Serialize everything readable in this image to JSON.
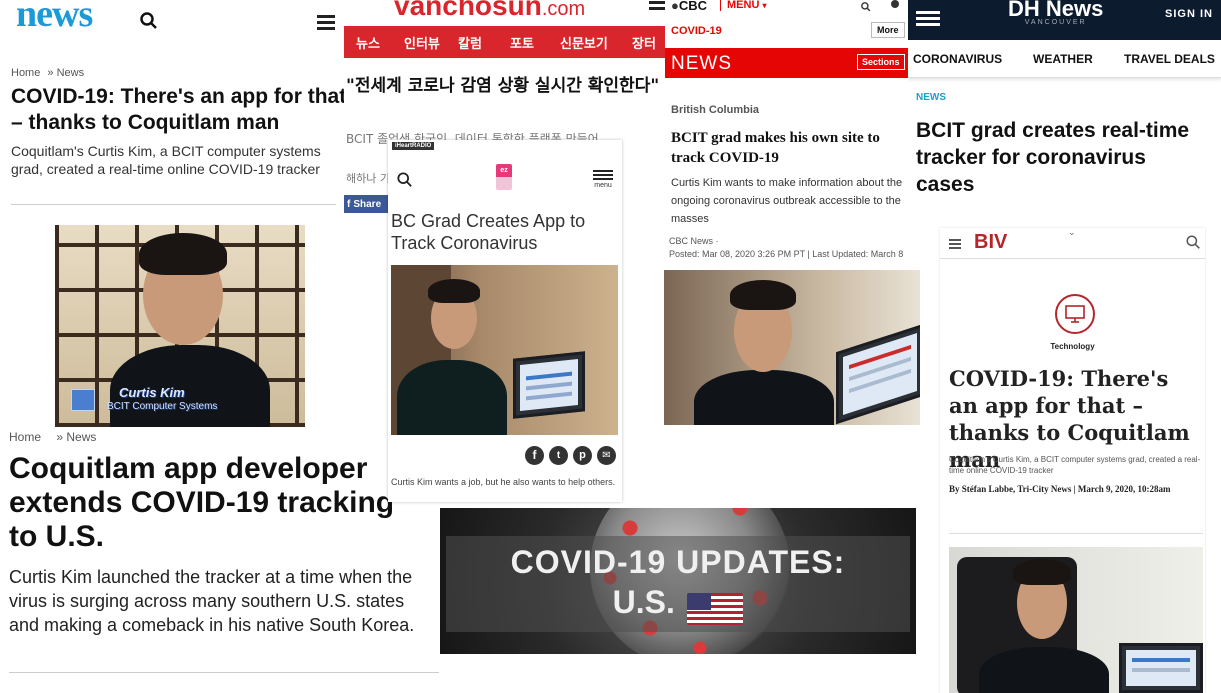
{
  "tricity": {
    "logo": "news",
    "breadcrumb_home": "Home",
    "breadcrumb_sep": "»",
    "breadcrumb_section": "News",
    "headline": "COVID-19: There's an app for that – thanks to Coquitlam man",
    "summary": "Coquitlam's Curtis Kim, a BCIT computer systems grad, created a real-time online COVID-19 tracker",
    "video_caption": "Curtis Kim",
    "video_subcaption": "BCIT Computer Systems",
    "breadcrumb2_home": "Home",
    "breadcrumb2_section": "» News",
    "headline2": "Coquitlam app developer extends COVID-19 tracking to U.S.",
    "summary2": "Curtis Kim launched the tracker at a time when the virus is surging across many southern U.S. states and making a comeback in his native South Korea."
  },
  "vanchosun": {
    "logo_main": "vanchosun",
    "logo_tld": ".com",
    "nav": [
      "뉴스",
      "인터뷰",
      "칼럼",
      "포토",
      "신문보기",
      "장터"
    ],
    "headline": "\"전세계 코로나 감염 상황 실시간 확인한다\"",
    "sub": "BCIT 졸업생 한국인, 데이터 통합한 플랫폼 만들어",
    "body_snip": "해하나 기",
    "share": "Share"
  },
  "iheart": {
    "badge": "iHeartRADIO",
    "menu_label": "menu",
    "logo_letters": "ez",
    "headline": "BC Grad Creates App to Track Coronavirus",
    "caption": "Curtis Kim wants a job, but he also wants to help others."
  },
  "cbc": {
    "logo": "CBC",
    "menu": "MENU",
    "tag": "COVID-19",
    "more": "More",
    "section": "NEWS",
    "sections_btn": "Sections",
    "region": "British Columbia",
    "headline": "BCIT grad makes his own site to track COVID-19",
    "summary": "Curtis Kim wants to make information about the ongoing coronavirus outbreak accessible to the masses",
    "byline": "CBC News ·",
    "posted": "Posted: Mar 08, 2020 3:26 PM PT | Last Updated: March 8"
  },
  "dhnews": {
    "logo": "DH News",
    "logo_sub": "VANCOUVER",
    "signin": "SIGN IN",
    "tabs": [
      "CORONAVIRUS",
      "WEATHER",
      "TRAVEL DEALS"
    ],
    "section": "NEWS",
    "headline": "BCIT grad creates real-time tracker for coronavirus cases"
  },
  "biv": {
    "logo": "BIV",
    "category": "Technology",
    "headline": "COVID-19: There's an app for that – thanks to Coquitlam man",
    "summary": "Coquitlam's Curtis Kim, a BCIT computer systems grad, created a real-time online COVID-19 tracker",
    "byline": "By Stéfan Labbe, Tri-City News | March 9, 2020, 10:28am"
  },
  "covid_banner": {
    "line1": "COVID-19 UPDATES:",
    "line2": "U.S."
  },
  "colors": {
    "tricity_blue": "#1a9ad6",
    "vanchosun_red": "#d9262c",
    "cbc_red": "#e60505",
    "dh_navy": "#0c1b2e",
    "biv_red": "#b5252a",
    "dh_teal": "#1ba0c8"
  }
}
